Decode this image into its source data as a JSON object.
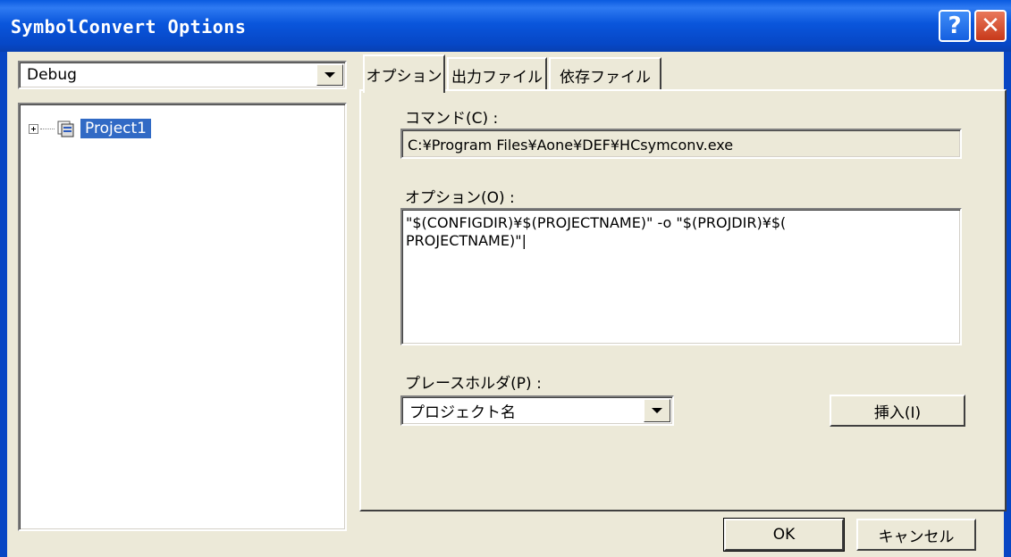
{
  "window": {
    "title": "SymbolConvert Options",
    "help_glyph": "?",
    "close_glyph": "✕"
  },
  "left": {
    "config_value": "Debug",
    "tree": [
      {
        "label": "Project1",
        "selected": true,
        "icon": "project-icon"
      }
    ]
  },
  "tabs": [
    {
      "label": "オプション",
      "active": true
    },
    {
      "label": "出力ファイル",
      "active": false
    },
    {
      "label": "依存ファイル",
      "active": false
    }
  ],
  "options_tab": {
    "command_label": "コマンド(C) :",
    "command_value": "C:¥Program Files¥Aone¥DEF¥HCsymconv.exe",
    "options_label": "オプション(O) :",
    "options_value": "\"$(CONFIGDIR)¥$(PROJECTNAME)\" -o \"$(PROJDIR)¥$(\nPROJECTNAME)\"|",
    "placeholder_label": "プレースホルダ(P) :",
    "placeholder_value": "プロジェクト名",
    "insert_label": "挿入(I)"
  },
  "footer": {
    "ok_label": "OK",
    "cancel_label": "キャンセル"
  }
}
